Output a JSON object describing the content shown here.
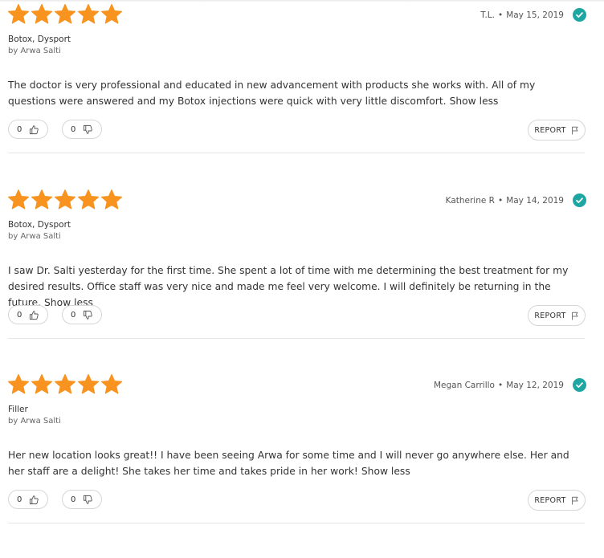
{
  "colors": {
    "star": "#f7931e",
    "verified": "#1ea6a3",
    "border": "#d6d6d6",
    "divider": "#e6e6e6"
  },
  "icons": {
    "star": "star-icon",
    "verified": "verified-check-icon",
    "up": "thumbs-up-icon",
    "down": "thumbs-down-icon",
    "flag": "flag-icon"
  },
  "reviews": [
    {
      "rating": 5,
      "author": "T.L.",
      "separator": "•",
      "date": "May 15, 2019",
      "treatment": "Botox, Dysport",
      "doctor": "by Arwa Salti",
      "text": "The doctor is very professional and educated in new advancement with products she works with. All of my questions were answered and my Botox injections were quick with very little discomfort.",
      "toggle": "Show less",
      "helpful": "0",
      "unhelpful": "0",
      "report": "REPORT"
    },
    {
      "rating": 5,
      "author": "Katherine R",
      "separator": "•",
      "date": "May 14, 2019",
      "treatment": "Botox, Dysport",
      "doctor": "by Arwa Salti",
      "text": "I saw Dr. Salti yesterday for the first time. She spent a lot of time with me determining the best treatment for my desired results. Office staff was very nice and made me feel very welcome. I will definitely be returning in the future.",
      "toggle": "Show less",
      "helpful": "0",
      "unhelpful": "0",
      "report": "REPORT"
    },
    {
      "rating": 5,
      "author": "Megan Carrillo",
      "separator": "•",
      "date": "May 12, 2019",
      "treatment": "Filler",
      "doctor": "by Arwa Salti",
      "text": "Her new location looks great!! I have been seeing Arwa for some time and I will never go anywhere else. Her and her staff are a delight! She takes her time and takes pride in her work!",
      "toggle": "Show less",
      "helpful": "0",
      "unhelpful": "0",
      "report": "REPORT"
    }
  ]
}
